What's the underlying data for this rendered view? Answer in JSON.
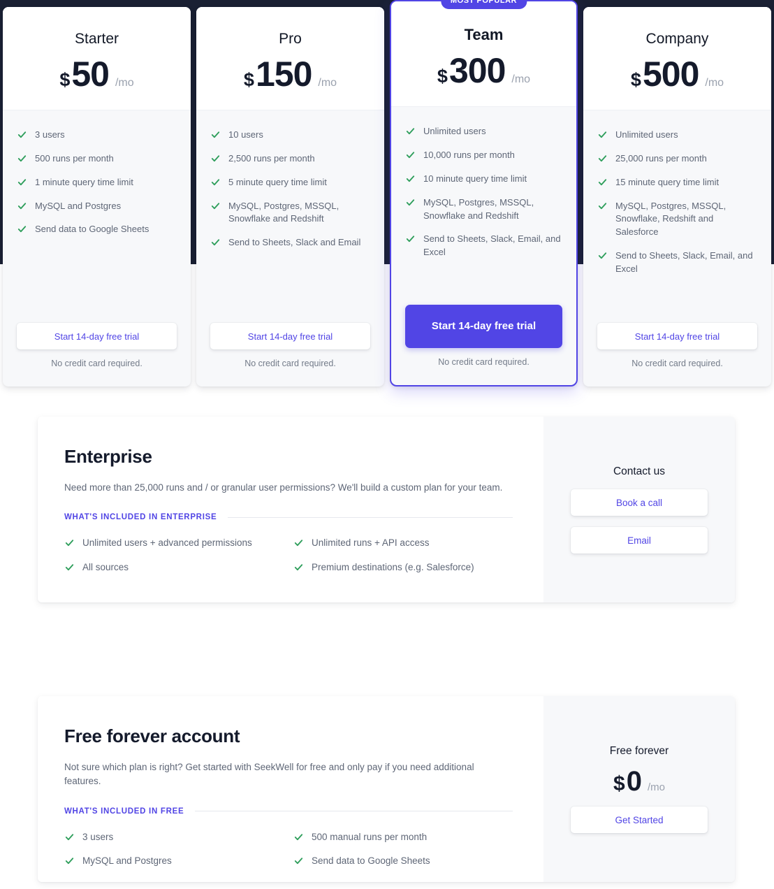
{
  "colors": {
    "accent_purple": "#5145e5",
    "check_green": "#2e9e5b",
    "dark_band": "#1a2033",
    "heading": "#141a2b",
    "body_text": "#5e6676"
  },
  "icons": {
    "check": "check-icon"
  },
  "plans": [
    {
      "name": "Starter",
      "currency": "$",
      "amount": "50",
      "period": "/mo",
      "featured": false,
      "badge": "",
      "features": [
        "3 users",
        "500 runs per month",
        "1 minute query time limit",
        "MySQL and Postgres",
        "Send data to Google Sheets"
      ],
      "cta": "Start 14-day free trial",
      "note": "No credit card required."
    },
    {
      "name": "Pro",
      "currency": "$",
      "amount": "150",
      "period": "/mo",
      "featured": false,
      "badge": "",
      "features": [
        "10 users",
        "2,500 runs per month",
        "5 minute query time limit",
        "MySQL, Postgres, MSSQL, Snowflake and Redshift",
        "Send to Sheets, Slack and Email"
      ],
      "cta": "Start 14-day free trial",
      "note": "No credit card required."
    },
    {
      "name": "Team",
      "currency": "$",
      "amount": "300",
      "period": "/mo",
      "featured": true,
      "badge": "MOST POPULAR",
      "features": [
        "Unlimited users",
        "10,000 runs per month",
        "10 minute query time limit",
        "MySQL, Postgres, MSSQL, Snowflake and Redshift",
        "Send to Sheets, Slack, Email, and Excel"
      ],
      "cta": "Start 14-day free trial",
      "note": "No credit card required."
    },
    {
      "name": "Company",
      "currency": "$",
      "amount": "500",
      "period": "/mo",
      "featured": false,
      "badge": "",
      "features": [
        "Unlimited users",
        "25,000 runs per month",
        "15 minute query time limit",
        "MySQL, Postgres, MSSQL, Snowflake, Redshift and Salesforce",
        "Send to Sheets, Slack, Email, and Excel"
      ],
      "cta": "Start 14-day free trial",
      "note": "No credit card required."
    }
  ],
  "enterprise": {
    "title": "Enterprise",
    "description": "Need more than 25,000 runs and / or granular user permissions? We'll build a custom plan for your team.",
    "included_label": "WHAT'S INCLUDED IN ENTERPRISE",
    "features": [
      "Unlimited users + advanced permissions",
      "Unlimited runs + API access",
      "All sources",
      "Premium destinations (e.g. Salesforce)"
    ],
    "side": {
      "title": "Contact us",
      "buttons": [
        "Book a call",
        "Email"
      ]
    }
  },
  "free": {
    "title": "Free forever account",
    "description": "Not sure which plan is right? Get started with SeekWell for free and only pay if you need additional features.",
    "included_label": "WHAT'S INCLUDED IN FREE",
    "features": [
      "3 users",
      "500 manual runs per month",
      "MySQL and Postgres",
      "Send data to Google Sheets"
    ],
    "side": {
      "title": "Free forever",
      "currency": "$",
      "amount": "0",
      "period": "/mo",
      "button": "Get Started"
    }
  }
}
